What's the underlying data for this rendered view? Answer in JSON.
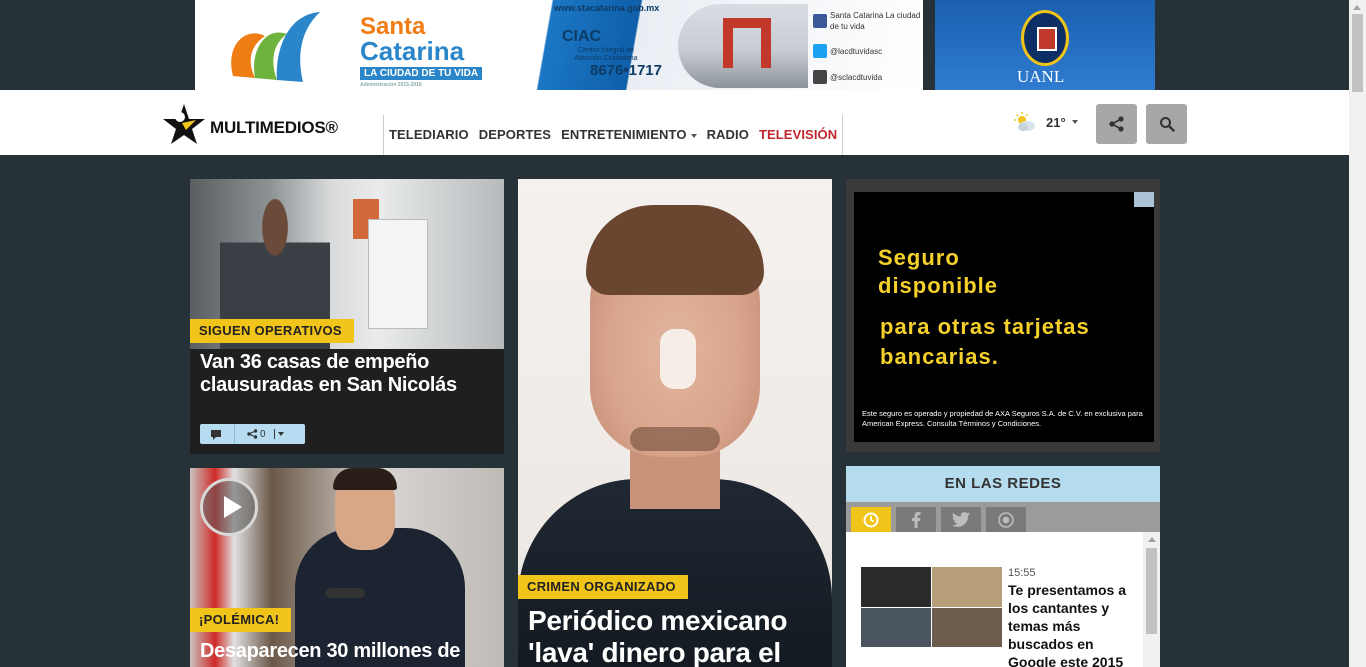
{
  "ads": {
    "top_banner": {
      "brand_line1": "Santa",
      "brand_line2": "Catarina",
      "slogan": "LA CIUDAD DE TU VIDA",
      "admin": "Administración 2015-2018",
      "url": "www.stacatarina.gob.mx",
      "ciac_title": "CIAC",
      "ciac_subtitle": "Centro Integral de Atención Ciudadana",
      "phone": "8676•1717",
      "social": [
        {
          "label": "Santa Catarina La ciudad de tu vida",
          "color": "#3b5998"
        },
        {
          "label": "@lacdtuvidasc",
          "color": "#1da1f2"
        },
        {
          "label": "@sclacdtuvida",
          "color": "#444444"
        }
      ]
    },
    "right_banner": {
      "name": "UANL"
    },
    "box": {
      "line1": "Seguro disponible",
      "line2": "para otras tarjetas bancarias.",
      "disclaimer": "Este seguro es operado y propiedad de AXA Seguros S.A. de C.V. en exclusiva para American Express. Consulta Términos y Condiciones."
    }
  },
  "header": {
    "logo_text": "MULTIMEDIOS®",
    "nav": [
      {
        "label": "TELEDIARIO"
      },
      {
        "label": "DEPORTES"
      },
      {
        "label": "ENTRETENIMIENTO"
      },
      {
        "label": "RADIO"
      },
      {
        "label": "TELEVISIÓN"
      }
    ],
    "weather": {
      "temp": "21°",
      "icon": "partly-sunny-icon"
    },
    "share_icon": "share-icon",
    "search_icon": "search-icon"
  },
  "stories": [
    {
      "tag": "SIGUEN OPERATIVOS",
      "headline": "Van 36 casas de empeño clausuradas en San Nicolás",
      "share_count": "0"
    },
    {
      "tag": "¡POLÉMICA!",
      "headline": "Desaparecen 30 millones de"
    },
    {
      "tag": "CRIMEN ORGANIZADO",
      "headline": "Periódico mexicano 'lava' dinero para el"
    }
  ],
  "redes": {
    "title": "EN LAS REDES",
    "tabs": [
      "clock-icon",
      "facebook-icon",
      "twitter-icon",
      "instagram-icon"
    ],
    "item": {
      "time": "15:55",
      "title": "Te presentamos a los cantantes y temas más buscados en Google este 2015"
    }
  },
  "colors": {
    "page_bg": "#263238",
    "accent_yellow": "#f0c419",
    "accent_red": "#c0272d",
    "redes_head": "#b4dbee"
  }
}
